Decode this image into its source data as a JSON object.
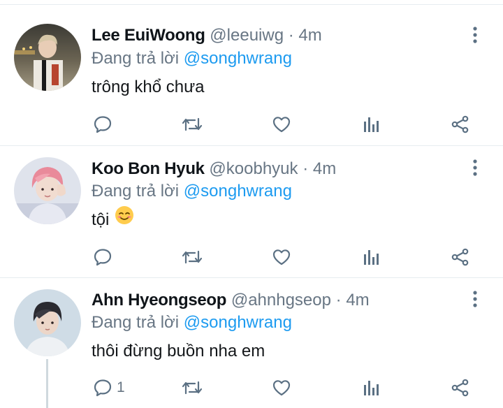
{
  "colors": {
    "accent": "#1d9bf0",
    "text_primary": "#0f1419",
    "text_secondary": "#687684",
    "divider": "#e6ecf0",
    "icon": "#5b7083"
  },
  "tweets": [
    {
      "display_name": "Lee EuiWoong",
      "handle": "@leeuiwg",
      "separator": "·",
      "time": "4m",
      "reply_prefix": "Đang trả lời",
      "reply_to": "@songhwrang",
      "text": "trông khổ chưa",
      "text_emoji": "",
      "reply_count": "",
      "icons": [
        "reply-icon",
        "retweet-icon",
        "like-icon",
        "analytics-icon",
        "share-icon",
        "more-vertical-icon"
      ]
    },
    {
      "display_name": "Koo Bon Hyuk",
      "handle": "@koobhyuk",
      "separator": "·",
      "time": "4m",
      "reply_prefix": "Đang trả lời",
      "reply_to": "@songhwrang",
      "text": "tội",
      "text_emoji": "☺️",
      "reply_count": "",
      "icons": [
        "reply-icon",
        "retweet-icon",
        "like-icon",
        "analytics-icon",
        "share-icon",
        "more-vertical-icon"
      ]
    },
    {
      "display_name": "Ahn Hyeongseop",
      "handle": "@ahnhgseop",
      "separator": "·",
      "time": "4m",
      "reply_prefix": "Đang trả lời",
      "reply_to": "@songhwrang",
      "text": "thôi đừng buồn nha em",
      "text_emoji": "",
      "reply_count": "1",
      "icons": [
        "reply-icon",
        "retweet-icon",
        "like-icon",
        "analytics-icon",
        "share-icon",
        "more-vertical-icon"
      ]
    }
  ]
}
